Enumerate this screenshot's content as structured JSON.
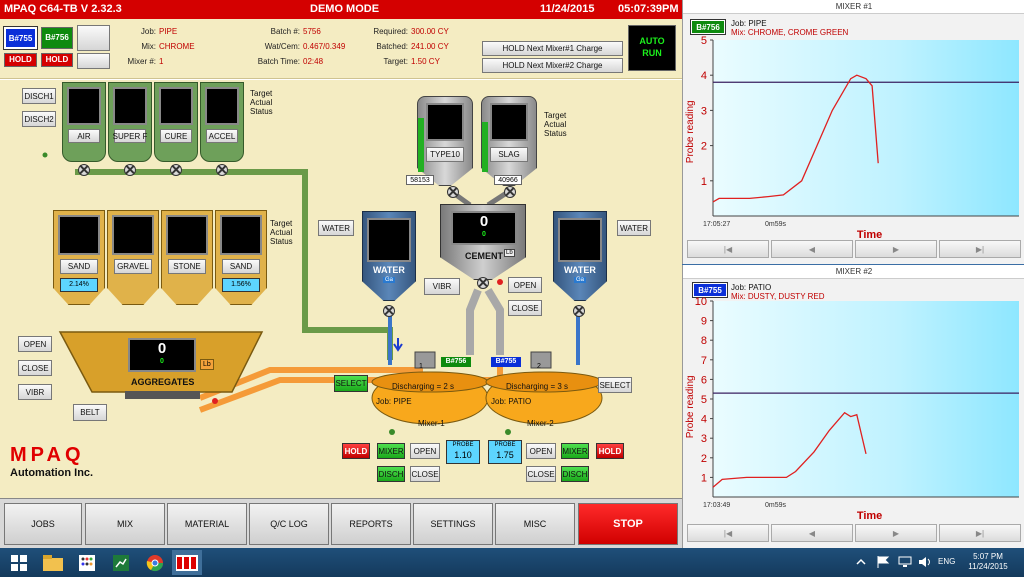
{
  "titlebar": {
    "app": "MPAQ C64-TB V 2.32.3",
    "mode": "DEMO MODE",
    "date": "11/24/2015",
    "time": "05:07:39PM"
  },
  "info": {
    "badge1": "B#755",
    "badge2": "B#756",
    "hold1": "HOLD",
    "hold2": "HOLD",
    "job_label": "Job:",
    "job": "PIPE",
    "mix_label": "Mix:",
    "mix": "CHROME",
    "mixer_label": "Mixer #:",
    "mixer": "1",
    "batch_label": "Batch #:",
    "batch": "5756",
    "watcem_label": "Wat/Cem:",
    "watcem": "0.467/0.349",
    "batchtime_label": "Batch Time:",
    "batchtime": "02:48",
    "required_label": "Required:",
    "required": "300.00 CY",
    "batched_label": "Batched:",
    "batched": "241.00 CY",
    "target_label": "Target:",
    "target": "1.50 CY",
    "hold_mixer1": "HOLD Next Mixer#1 Charge",
    "hold_mixer2": "HOLD Next Mixer#2 Charge",
    "auto": "AUTO",
    "run": "RUN"
  },
  "plant": {
    "disch1": "DISCH1",
    "disch2": "DISCH2",
    "admix": [
      "AIR",
      "SUPER F",
      "CURE",
      "ACCEL"
    ],
    "tas": [
      "Target",
      "Actual",
      "Status"
    ],
    "cement_bins": [
      "TYPE10",
      "SLAG"
    ],
    "cement_counts": [
      "58153",
      "40966"
    ],
    "aggs": [
      "SAND",
      "GRAVEL",
      "STONE",
      "SAND"
    ],
    "agg_pct": [
      "2.14%",
      "1.56%"
    ],
    "water_btn": "WATER",
    "water_label": "WATER",
    "water_unit": "Ga",
    "cement_value": "0",
    "cement_sub": "0",
    "cement_label": "CEMENT",
    "cement_unit": "Lb",
    "vibr": "VIBR",
    "open": "OPEN",
    "close": "CLOSE",
    "agg_value": "0",
    "agg_sub": "0",
    "agg_label": "AGGREGATES",
    "agg_unit": "Lb",
    "belt": "BELT",
    "select": "SELECT",
    "tag1": "B#756",
    "tag2": "B#755",
    "mixer1": {
      "num": "1",
      "discharging": "Discharging = 2 s",
      "job": "Job: PIPE",
      "name": "Mixer-1"
    },
    "mixer2": {
      "num": "2",
      "discharging": "Discharging = 3 s",
      "job": "Job: PATIO",
      "name": "Mixer-2"
    },
    "hold": "HOLD",
    "mixer": "MIXER",
    "disch": "DISCH",
    "probe_label": "PROBE",
    "probe1": "1.10",
    "probe2": "1.75",
    "logo": "MPAQ",
    "company": "Automation Inc."
  },
  "nav": [
    "JOBS",
    "MIX",
    "MATERIAL",
    "Q/C LOG",
    "REPORTS",
    "SETTINGS",
    "MISC",
    "STOP"
  ],
  "chart_data": [
    {
      "type": "line",
      "title": "MIXER #1",
      "badge": "B#756",
      "job": "Job: PIPE",
      "mix": "Mix: CHROME, CROME GREEN",
      "xlabel": "Time",
      "ylabel": "Probe reading",
      "ylim": [
        0,
        5
      ],
      "yticks": [
        1,
        2,
        3,
        4,
        5
      ],
      "xticks": [
        "17:05:27",
        "0m59s"
      ],
      "target_line": 3.8,
      "series": [
        {
          "values": [
            [
              0.0,
              0.4
            ],
            [
              0.02,
              0.5
            ],
            [
              0.12,
              0.5
            ],
            [
              0.18,
              0.55
            ],
            [
              0.23,
              0.6
            ],
            [
              0.29,
              1.0
            ],
            [
              0.34,
              2.0
            ],
            [
              0.39,
              3.0
            ],
            [
              0.45,
              3.9
            ],
            [
              0.47,
              4.0
            ],
            [
              0.5,
              3.9
            ],
            [
              0.52,
              3.7
            ],
            [
              0.54,
              1.5
            ]
          ]
        }
      ]
    },
    {
      "type": "line",
      "title": "MIXER #2",
      "badge": "B#755",
      "job": "Job: PATIO",
      "mix": "Mix: DUSTY, DUSTY RED",
      "xlabel": "Time",
      "ylabel": "Probe reading",
      "ylim": [
        0,
        10
      ],
      "yticks": [
        1,
        2,
        3,
        4,
        5,
        6,
        7,
        8,
        9,
        10
      ],
      "xticks": [
        "17:03:49",
        "0m59s"
      ],
      "target_line": 5.3,
      "series": [
        {
          "values": [
            [
              0.0,
              0.5
            ],
            [
              0.03,
              0.9
            ],
            [
              0.11,
              1.0
            ],
            [
              0.24,
              1.0
            ],
            [
              0.27,
              1.3
            ],
            [
              0.33,
              2.3
            ],
            [
              0.38,
              3.4
            ],
            [
              0.43,
              4.3
            ],
            [
              0.45,
              4.1
            ],
            [
              0.47,
              4.2
            ],
            [
              0.5,
              2.2
            ]
          ]
        }
      ]
    }
  ],
  "chart_nav": [
    "|◀",
    "◀",
    "▶",
    "▶|"
  ],
  "taskbar": {
    "time": "5:07 PM",
    "date": "11/24/2015",
    "lang": "ENG"
  }
}
